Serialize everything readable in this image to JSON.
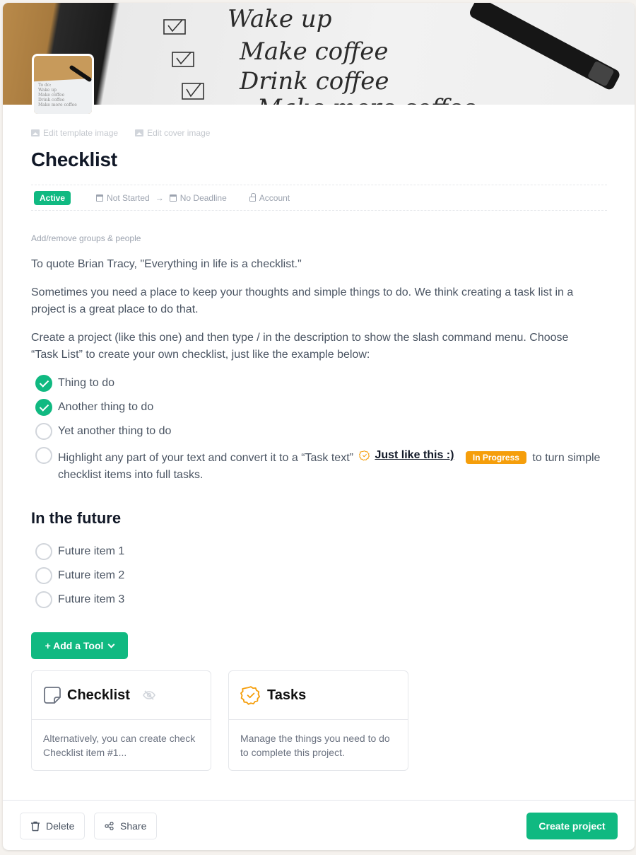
{
  "cover": {
    "image_alt": "Handwritten checklist: Wake up, Make coffee, Drink coffee, Make more coffee",
    "handwriting": [
      "Wake up",
      "Make coffee",
      "Drink coffee",
      "Make more coffee"
    ],
    "thumbnail_lines": [
      "To do:",
      "Wake up",
      "Make coffee",
      "Drink coffee",
      "Make more coffee"
    ]
  },
  "edit_links": {
    "template_image": "Edit template image",
    "cover_image": "Edit cover image"
  },
  "title": "Checklist",
  "meta": {
    "status": "Active",
    "start": "Not Started",
    "arrow": "→",
    "deadline": "No Deadline",
    "account": "Account"
  },
  "groups_link": "Add/remove groups & people",
  "description": [
    "To quote Brian Tracy, \"Everything in life is a checklist.\"",
    "Sometimes you need a place to keep your thoughts and simple things to do. We think creating a task list in a project is a great place to do that.",
    "Create a project (like this one) and then type / in the description to show the slash command menu. Choose “Task List” to create your own checklist, just like the example below:"
  ],
  "checklist": [
    {
      "text": "Thing to do",
      "done": true
    },
    {
      "text": "Another thing to do",
      "done": true
    },
    {
      "text": "Yet another thing to do",
      "done": false
    }
  ],
  "highlight_item": {
    "done": false,
    "before": "Highlight any part of your text and convert it to a “Task text”",
    "link": "Just like this :)",
    "badge": "In Progress",
    "after": "to turn simple checklist items into full tasks."
  },
  "future": {
    "heading": "In the future",
    "items": [
      {
        "text": "Future item 1",
        "done": false
      },
      {
        "text": "Future item 2",
        "done": false
      },
      {
        "text": "Future item 3",
        "done": false
      }
    ]
  },
  "add_tool_label": "+ Add a Tool",
  "tools": [
    {
      "title": "Checklist",
      "icon": "note-icon",
      "hidden": true,
      "description": "Alternatively, you can create check Checklist item #1..."
    },
    {
      "title": "Tasks",
      "icon": "badge-check-icon",
      "hidden": false,
      "description": "Manage the things you need to do to complete this project."
    }
  ],
  "tools_desc_lines": {
    "checklist_line1": "Alternatively, you can create check",
    "checklist_line2": "Checklist item #1..."
  },
  "footer": {
    "delete": "Delete",
    "share": "Share",
    "create": "Create project"
  },
  "colors": {
    "accent": "#10b981",
    "in_progress": "#f59e0b",
    "title": "#111827",
    "body_text": "#4b5563",
    "muted": "#9ca3af"
  }
}
